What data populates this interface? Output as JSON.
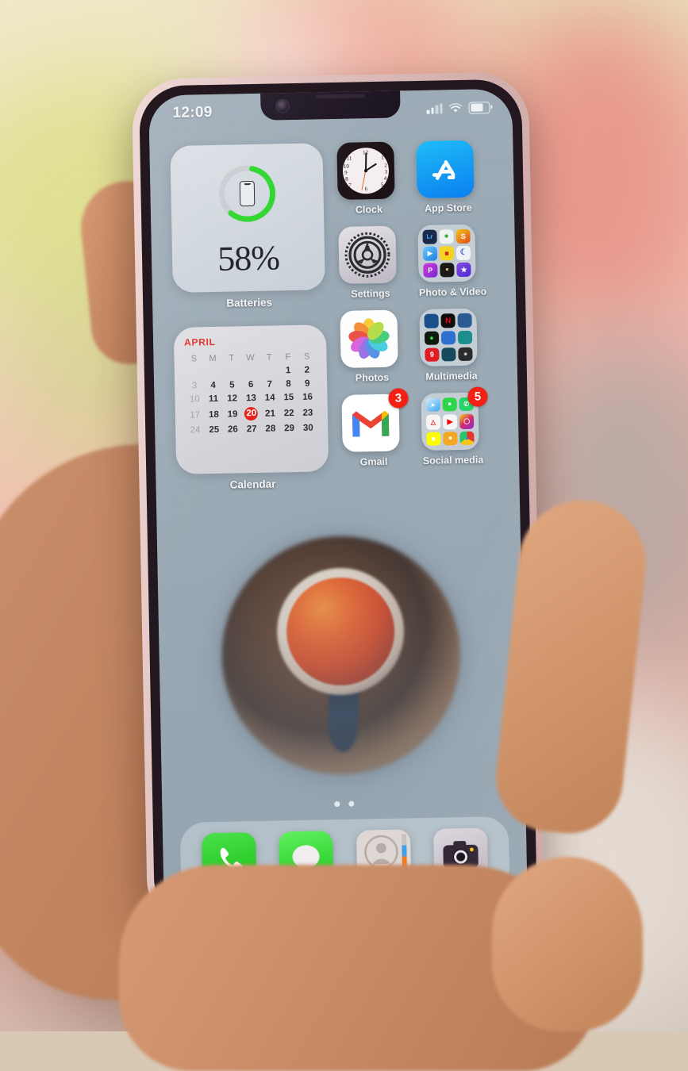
{
  "status_bar": {
    "time": "12:09",
    "signal_icon": "cellular-signal-icon",
    "wifi_icon": "wifi-icon",
    "battery_icon": "battery-icon",
    "battery_level_percent": 60
  },
  "widgets": {
    "batteries": {
      "label": "Batteries",
      "percent_text": "58%",
      "percent_value": 58,
      "ring_color": "#2bd62b",
      "ring_track_color": "#c9ccd1",
      "device_icon": "iphone-icon"
    },
    "calendar": {
      "label": "Calendar",
      "month": "APRIL",
      "month_color": "#e0302a",
      "today": 20,
      "today_highlight_color": "#e8221c",
      "weekday_headers": [
        "S",
        "M",
        "T",
        "W",
        "T",
        "F",
        "S"
      ],
      "weeks": [
        [
          "",
          "",
          "",
          "",
          "",
          "1",
          "2"
        ],
        [
          "3",
          "4",
          "5",
          "6",
          "7",
          "8",
          "9"
        ],
        [
          "10",
          "11",
          "12",
          "13",
          "14",
          "15",
          "16"
        ],
        [
          "17",
          "18",
          "19",
          "20",
          "21",
          "22",
          "23"
        ],
        [
          "24",
          "25",
          "26",
          "27",
          "28",
          "29",
          "30"
        ]
      ]
    }
  },
  "apps": [
    {
      "name": "Clock",
      "icon": "clock-icon",
      "badge": null
    },
    {
      "name": "App Store",
      "icon": "app-store-icon",
      "badge": null
    },
    {
      "name": "Settings",
      "icon": "settings-gear-icon",
      "badge": null
    },
    {
      "name": "Photo & Video",
      "icon": "folder-icon",
      "badge": null
    },
    {
      "name": "Photos",
      "icon": "photos-flower-icon",
      "badge": null
    },
    {
      "name": "Multimedia",
      "icon": "folder-icon",
      "badge": null
    },
    {
      "name": "Gmail",
      "icon": "gmail-icon",
      "badge": "3"
    },
    {
      "name": "Social media",
      "icon": "folder-icon",
      "badge": "5"
    }
  ],
  "folders": {
    "photo_video": {
      "label": "Photo & Video",
      "mini_icons": [
        {
          "name": "lightroom",
          "color": "#1b2a4a",
          "glyph": "Lr"
        },
        {
          "name": "leaf-app",
          "color": "#eef2f0",
          "glyph": ""
        },
        {
          "name": "snapseed",
          "color": "#f2c21a",
          "glyph": "S"
        },
        {
          "name": "video-player",
          "color": "#3aa8f5",
          "glyph": "▶"
        },
        {
          "name": "youtube-studio",
          "color": "#f5d321",
          "glyph": ""
        },
        {
          "name": "moon-app",
          "color": "#eef2f5",
          "glyph": "☾"
        },
        {
          "name": "picsart",
          "color": "#a736d6",
          "glyph": "P"
        },
        {
          "name": "dark-editor",
          "color": "#1c1a18",
          "glyph": ""
        },
        {
          "name": "star-app",
          "color": "#6b3ad6",
          "glyph": "★"
        }
      ]
    },
    "multimedia": {
      "label": "Multimedia",
      "mini_icons": [
        {
          "name": "blue-media-app",
          "color": "#1a4f8a",
          "glyph": ""
        },
        {
          "name": "netflix",
          "color": "#b10b0b",
          "glyph": "N"
        },
        {
          "name": "blue-player-app",
          "color": "#2a5c93",
          "glyph": ""
        },
        {
          "name": "green-music-app",
          "color": "#14a83c",
          "glyph": ""
        },
        {
          "name": "blue-video-app",
          "color": "#2f6fd0",
          "glyph": ""
        },
        {
          "name": "teal-app",
          "color": "#1c8e8e",
          "glyph": ""
        },
        {
          "name": "nine-app",
          "color": "#e01b24",
          "glyph": "9"
        },
        {
          "name": "dark-teal-app",
          "color": "#174a5c",
          "glyph": ""
        },
        {
          "name": "grey-circle-app",
          "color": "#2b2b2b",
          "glyph": ""
        }
      ]
    },
    "social_media": {
      "label": "Social media",
      "mini_icons": [
        {
          "name": "safari",
          "color": "#f0f4f8",
          "glyph": ""
        },
        {
          "name": "facetime",
          "color": "#2bd648",
          "glyph": ""
        },
        {
          "name": "whatsapp",
          "color": "#25d366",
          "glyph": ""
        },
        {
          "name": "white-red-app",
          "color": "#f7f4f2",
          "glyph": ""
        },
        {
          "name": "youtube",
          "color": "#ff0000",
          "glyph": ""
        },
        {
          "name": "instagram",
          "color": "#c13584",
          "glyph": ""
        },
        {
          "name": "snapchat",
          "color": "#fffc00",
          "glyph": ""
        },
        {
          "name": "orange-doc-app",
          "color": "#f5a623",
          "glyph": ""
        },
        {
          "name": "chrome",
          "color": "#f8f8f8",
          "glyph": ""
        }
      ]
    }
  },
  "dock": [
    {
      "name": "Phone",
      "icon": "phone-handset-icon"
    },
    {
      "name": "Messages",
      "icon": "message-bubble-icon"
    },
    {
      "name": "Contacts",
      "icon": "contacts-person-icon"
    },
    {
      "name": "Camera",
      "icon": "camera-icon"
    }
  ],
  "page_indicator": {
    "pages": 2,
    "current": 1
  },
  "colors": {
    "badge_red": "#f32013",
    "accent_green": "#2bd62b",
    "screen_bg": "#9aa9b4"
  }
}
